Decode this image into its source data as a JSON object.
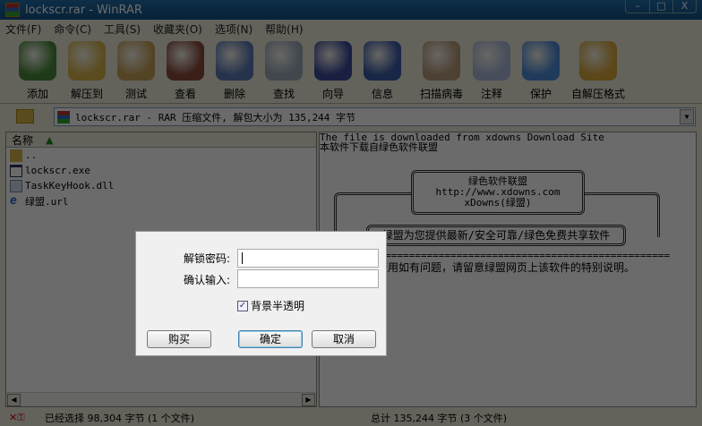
{
  "window": {
    "title": "lockscr.rar - WinRAR",
    "min": "–",
    "max": "□",
    "close": "X"
  },
  "menu": [
    "文件(F)",
    "命令(C)",
    "工具(S)",
    "收藏夹(O)",
    "选项(N)",
    "帮助(H)"
  ],
  "toolbar": [
    {
      "label": "添加",
      "color": "#4a8a3a"
    },
    {
      "label": "解压到",
      "color": "#d9b44a"
    },
    {
      "label": "测试",
      "color": "#c9a25a"
    },
    {
      "label": "查看",
      "color": "#8a4a3a"
    },
    {
      "label": "删除",
      "color": "#5a7ab8"
    },
    {
      "label": "查找",
      "color": "#9aa8b8"
    },
    {
      "label": "向导",
      "color": "#3a4a9a"
    },
    {
      "label": "信息",
      "color": "#3a5aa8"
    },
    {
      "label": "扫描病毒",
      "color": "#b89a7a"
    },
    {
      "label": "注释",
      "color": "#a8b8d8"
    },
    {
      "label": "保护",
      "color": "#4a8ad8"
    },
    {
      "label": "自解压格式",
      "color": "#d9a83a"
    }
  ],
  "address": {
    "text": "lockscr.rar - RAR 压缩文件, 解包大小为 135,244 字节"
  },
  "filelist": {
    "column": "名称",
    "files": [
      {
        "name": "..",
        "type": "folder"
      },
      {
        "name": "lockscr.exe",
        "type": "exe"
      },
      {
        "name": "TaskKeyHook.dll",
        "type": "dll"
      },
      {
        "name": "绿盟.url",
        "type": "url"
      }
    ]
  },
  "comment": {
    "line1": "The file is downloaded from xdowns Download Site",
    "line2": "本软件下载自绿色软件联盟",
    "box_title": "绿色软件联盟",
    "box_url": "http://www.xdowns.com",
    "box_name": "xDowns(绿盟)",
    "slogan": "绿盟为您提供最新/安全可靠/绿色免费共享软件",
    "separator": "=====================================================",
    "note": "安装使用如有问题，请留意绿盟网页上该软件的特别说明。"
  },
  "status": {
    "selected": "已经选择 98,304 字节 (1 个文件)",
    "total": "总计 135,244 字节 (3 个文件)"
  },
  "dialog": {
    "password_label": "解锁密码:",
    "password_value": "",
    "confirm_label": "确认输入:",
    "confirm_value": "",
    "checkbox_label": "背景半透明",
    "checkbox_checked": true,
    "buy": "购买",
    "ok": "确定",
    "cancel": "取消"
  }
}
